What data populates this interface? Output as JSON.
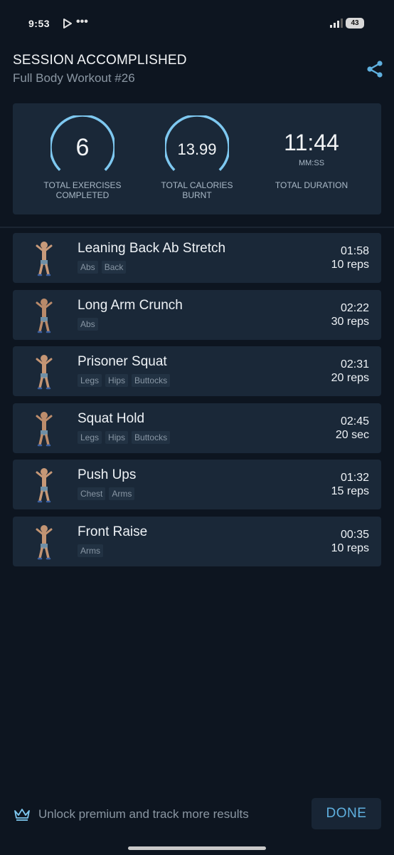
{
  "status_bar": {
    "time": "9:53",
    "dots": "•••",
    "battery": "43"
  },
  "header": {
    "title": "SESSION ACCOMPLISHED",
    "subtitle": "Full Body Workout #26"
  },
  "summary": {
    "exercises": {
      "value": "6",
      "label_line1": "TOTAL EXERCISES",
      "label_line2": "COMPLETED"
    },
    "calories": {
      "value": "13.99",
      "label_line1": "TOTAL CALORIES",
      "label_line2": "BURNT"
    },
    "duration": {
      "value": "11:44",
      "unit": "MM:SS",
      "label": "TOTAL DURATION"
    }
  },
  "exercises": [
    {
      "name": "Leaning Back Ab Stretch",
      "tags": [
        "Abs",
        "Back"
      ],
      "time": "01:58",
      "amount": "10 reps"
    },
    {
      "name": "Long Arm Crunch",
      "tags": [
        "Abs"
      ],
      "time": "02:22",
      "amount": "30 reps"
    },
    {
      "name": "Prisoner Squat",
      "tags": [
        "Legs",
        "Hips",
        "Buttocks"
      ],
      "time": "02:31",
      "amount": "20 reps"
    },
    {
      "name": "Squat Hold",
      "tags": [
        "Legs",
        "Hips",
        "Buttocks"
      ],
      "time": "02:45",
      "amount": "20 sec"
    },
    {
      "name": "Push Ups",
      "tags": [
        "Chest",
        "Arms"
      ],
      "time": "01:32",
      "amount": "15 reps"
    },
    {
      "name": "Front Raise",
      "tags": [
        "Arms"
      ],
      "time": "00:35",
      "amount": "10 reps"
    }
  ],
  "footer": {
    "promo": "Unlock premium and track more results",
    "done_label": "DONE"
  },
  "colors": {
    "background": "#0d1520",
    "card": "#1a2838",
    "accent": "#7ec8f0",
    "button_text": "#5fb0df"
  }
}
